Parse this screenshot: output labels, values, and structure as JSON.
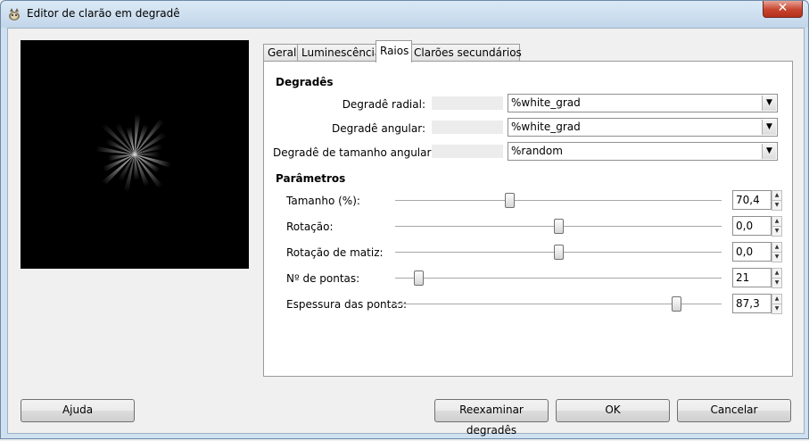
{
  "window": {
    "title": "Editor de clarão em degradê",
    "close_label": "✕"
  },
  "tabs": [
    {
      "label": "Geral",
      "active": false
    },
    {
      "label": "Luminescência",
      "active": false
    },
    {
      "label": "Raios",
      "active": true
    },
    {
      "label": "Clarões secundários",
      "active": false
    }
  ],
  "gradients": {
    "title": "Degradês",
    "rows": [
      {
        "label": "Degradê radial:",
        "value": "%white_grad"
      },
      {
        "label": "Degradê angular:",
        "value": "%white_grad"
      },
      {
        "label": "Degradê de tamanho angular:",
        "value": "%random"
      }
    ]
  },
  "parameters": {
    "title": "Parâmetros",
    "rows": [
      {
        "label": "Tamanho (%):",
        "value": "70,4",
        "slider_fraction": 0.35
      },
      {
        "label": "Rotação:",
        "value": "0,0",
        "slider_fraction": 0.5
      },
      {
        "label": "Rotação de matiz:",
        "value": "0,0",
        "slider_fraction": 0.5
      },
      {
        "label": "Nº de pontas:",
        "value": "21",
        "slider_fraction": 0.07
      },
      {
        "label": "Espessura das pontas:",
        "value": "87,3",
        "slider_fraction": 0.86
      }
    ]
  },
  "buttons": {
    "help": "Ajuda",
    "rescan": "Reexaminar degradês",
    "ok": "OK",
    "cancel": "Cancelar"
  },
  "icons": {
    "window": "gimp-icon",
    "combo_arrow": "chevron-down-icon",
    "spin_up": "spin-up-icon",
    "spin_down": "spin-down-icon"
  }
}
